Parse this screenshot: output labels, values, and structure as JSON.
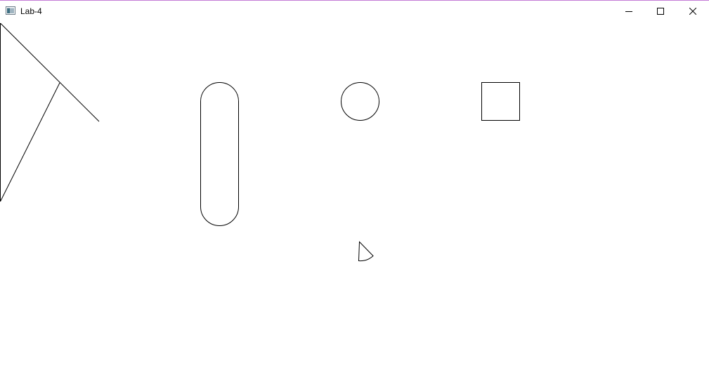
{
  "window": {
    "title": "Lab-4",
    "accent_border_color": "#c37bd6"
  },
  "titlebar": {
    "app_icon": "window-app-icon",
    "controls": [
      {
        "name": "minimize",
        "icon": "minimize-icon"
      },
      {
        "name": "maximize",
        "icon": "maximize-icon"
      },
      {
        "name": "close",
        "icon": "close-icon"
      }
    ]
  },
  "canvas": {
    "background": "#ffffff",
    "stroke_color": "#000000",
    "shapes": [
      "lines",
      "capsule",
      "circle",
      "square",
      "pie-slice"
    ]
  }
}
